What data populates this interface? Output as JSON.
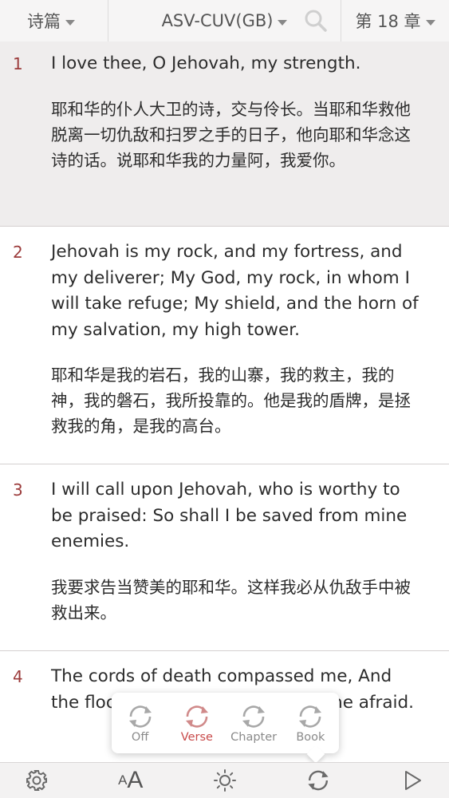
{
  "header": {
    "book": "诗篇",
    "version": "ASV-CUV(GB)",
    "chapter": "第 18 章"
  },
  "verses": [
    {
      "num": "1",
      "en": "I love thee, O Jehovah, my strength.",
      "zh": "耶和华的仆人大卫的诗，交与伶长。当耶和华救他脱离一切仇敌和扫罗之手的日子，他向耶和华念这诗的话。说耶和华我的力量阿，我爱你。",
      "highlighted": true
    },
    {
      "num": "2",
      "en": "Jehovah is my rock, and my fortress, and my deliverer; My God, my rock, in whom I will take refuge; My shield, and the horn of my salvation, my high tower.",
      "zh": "耶和华是我的岩石，我的山寨，我的救主，我的神，我的磐石，我所投靠的。他是我的盾牌，是拯救我的角，是我的高台。",
      "highlighted": false
    },
    {
      "num": "3",
      "en": "I will call upon Jehovah, who is worthy to be praised: So shall I be saved from mine enemies.",
      "zh": "我要求告当赞美的耶和华。这样我必从仇敌手中被救出来。",
      "highlighted": false
    },
    {
      "num": "4",
      "en": "The cords of death compassed me, And the floods of ungodliness made me afraid.",
      "zh": "",
      "highlighted": false
    }
  ],
  "repeat_popup": {
    "options": [
      {
        "label": "Off",
        "active": false
      },
      {
        "label": "Verse",
        "active": true
      },
      {
        "label": "Chapter",
        "active": false
      },
      {
        "label": "Book",
        "active": false
      }
    ]
  },
  "toolbar": {
    "font_small": "A",
    "font_large": "A",
    "icons": [
      "gear-icon",
      "font-size-icon",
      "brightness-icon",
      "repeat-icon",
      "play-icon"
    ]
  },
  "colors": {
    "accent": "#c84a4a",
    "verse_number": "#9b3b3b",
    "highlight_bg": "#efeded"
  }
}
